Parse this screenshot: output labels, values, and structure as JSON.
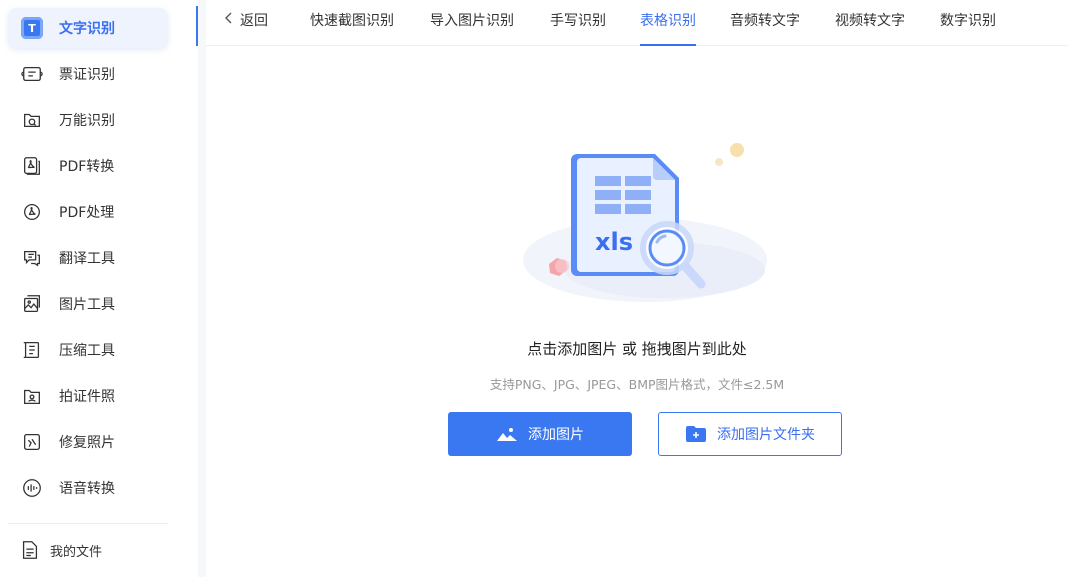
{
  "sidebar": {
    "active_item": {
      "label": "文字识别",
      "icon": "text-recognition-icon",
      "icon_glyph": "T"
    },
    "items": [
      {
        "label": "票证识别",
        "icon": "ticket-icon"
      },
      {
        "label": "万能识别",
        "icon": "universal-scan-icon"
      },
      {
        "label": "PDF转换",
        "icon": "pdf-convert-icon"
      },
      {
        "label": "PDF处理",
        "icon": "pdf-process-icon"
      },
      {
        "label": "翻译工具",
        "icon": "translate-icon"
      },
      {
        "label": "图片工具",
        "icon": "image-tools-icon"
      },
      {
        "label": "压缩工具",
        "icon": "compress-icon"
      },
      {
        "label": "拍证件照",
        "icon": "id-photo-icon"
      },
      {
        "label": "修复照片",
        "icon": "repair-photo-icon"
      },
      {
        "label": "语音转换",
        "icon": "voice-convert-icon"
      }
    ],
    "my_files": {
      "label": "我的文件",
      "icon": "my-files-icon"
    }
  },
  "topbar": {
    "back_label": "返回",
    "tabs": [
      {
        "label": "快速截图识别"
      },
      {
        "label": "导入图片识别"
      },
      {
        "label": "手写识别"
      },
      {
        "label": "表格识别",
        "active": true
      },
      {
        "label": "音频转文字"
      },
      {
        "label": "视频转文字"
      },
      {
        "label": "数字识别"
      }
    ]
  },
  "main": {
    "illustration_label": "xls",
    "drop_hint": "点击添加图片 或 拖拽图片到此处",
    "format_hint": "支持PNG、JPG、JPEG、BMP图片格式，文件≤2.5M",
    "add_image_button": "添加图片",
    "add_folder_button": "添加图片文件夹"
  },
  "colors": {
    "accent": "#3a78f2",
    "active_text": "#3a6ff0",
    "hint_gray": "#999999"
  }
}
